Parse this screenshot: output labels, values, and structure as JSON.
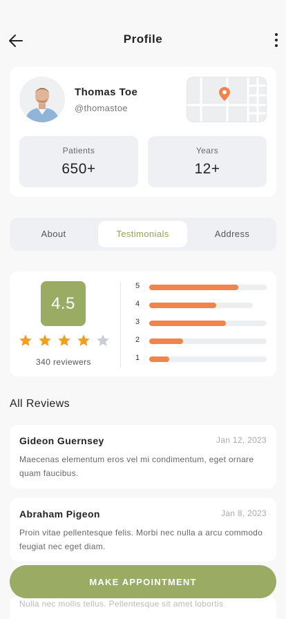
{
  "header": {
    "title": "Profile",
    "back_icon": "arrow-left-icon",
    "more_icon": "more-vertical-icon"
  },
  "profile": {
    "name": "Thomas Toe",
    "handle": "@thomastoe",
    "map_icon": "map-pin-icon",
    "stats": [
      {
        "label": "Patients",
        "value": "650+"
      },
      {
        "label": "Years",
        "value": "12+"
      }
    ]
  },
  "tabs": [
    {
      "label": "About",
      "active": false
    },
    {
      "label": "Testimonials",
      "active": true
    },
    {
      "label": "Address",
      "active": false
    }
  ],
  "rating": {
    "score": "4.5",
    "stars_filled": 4,
    "stars_total": 5,
    "reviewers": "340 reviewers",
    "distribution": [
      {
        "label": "5",
        "fraction": 0.76
      },
      {
        "label": "4",
        "fraction": 0.57
      },
      {
        "label": "3",
        "fraction": 0.65
      },
      {
        "label": "2",
        "fraction": 0.29
      },
      {
        "label": "1",
        "fraction": 0.17
      }
    ]
  },
  "reviews_section": {
    "title": "All Reviews",
    "items": [
      {
        "name": "Gideon Guernsey",
        "date": "Jan 12, 2023",
        "text": "Maecenas elementum eros vel mi condimentum, eget ornare quam faucibus."
      },
      {
        "name": "Abraham Pigeon",
        "date": "Jan 8, 2023",
        "text": "Proin vitae pellentesque felis. Morbi nec nulla a arcu commodo feugiat nec eget diam."
      }
    ],
    "partial_text": "Nulla nec mollis tellus. Pellentesque sit amet lobortis"
  },
  "cta": {
    "label": "MAKE APPOINTMENT"
  },
  "colors": {
    "accent": "#9aac64",
    "bar": "#f0844a",
    "star": "#f0a020",
    "star_empty": "#c9ccd3",
    "active_tab_text": "#8ea65c"
  }
}
